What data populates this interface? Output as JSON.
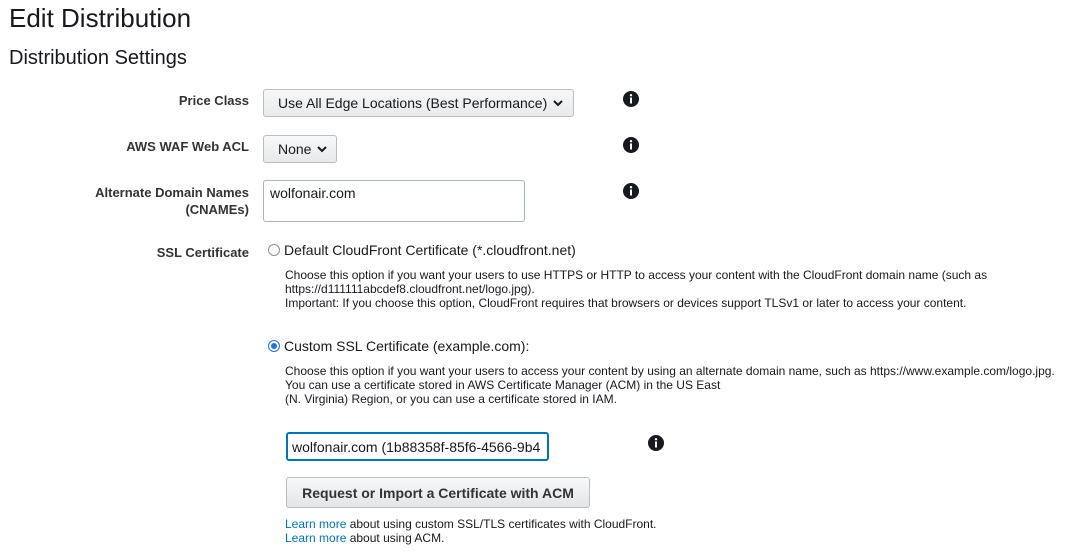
{
  "page_title": "Edit Distribution",
  "section_title": "Distribution Settings",
  "price_class": {
    "label": "Price Class",
    "selected": "Use All Edge Locations (Best Performance)"
  },
  "waf": {
    "label": "AWS WAF Web ACL",
    "selected": "None"
  },
  "cnames": {
    "label_line1": "Alternate Domain Names",
    "label_line2": "(CNAMEs)",
    "value": "wolfonair.com"
  },
  "ssl": {
    "label": "SSL Certificate",
    "default_option": {
      "label": "Default CloudFront Certificate (*.cloudfront.net)",
      "checked": false,
      "desc_line1": "Choose this option if you want your users to use HTTPS or HTTP to access your content with the CloudFront domain name (such as",
      "desc_line2": "https://d111111abcdef8.cloudfront.net/logo.jpg).",
      "desc_line3": "Important: If you choose this option, CloudFront requires that browsers or devices support TLSv1 or later to access your content."
    },
    "custom_option": {
      "label": "Custom SSL Certificate (example.com):",
      "checked": true,
      "desc_line1": "Choose this option if you want your users to access your content by using an alternate domain name, such as https://www.example.com/logo.jpg.",
      "desc_line2": "You can use a certificate stored in AWS Certificate Manager (ACM) in the US East",
      "desc_line3": "(N. Virginia) Region, or you can use a certificate stored in IAM."
    },
    "certificate_value": "wolfonair.com (1b88358f-85f6-4566-9b4",
    "acm_button": "Request or Import a Certificate with ACM",
    "footer": {
      "link1": "Learn more",
      "text1": " about using custom SSL/TLS certificates with CloudFront.",
      "link2": "Learn more",
      "text2": " about using ACM."
    }
  },
  "colors": {
    "link": "#0073bb",
    "focus_border": "#0073bb",
    "radio_selected": "#1a73e8"
  },
  "icons": [
    "info-icon",
    "chevron-down-icon"
  ]
}
